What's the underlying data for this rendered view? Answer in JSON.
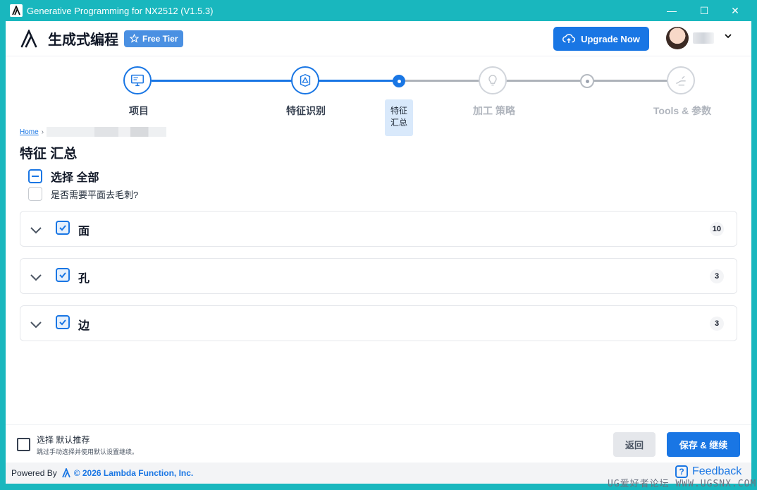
{
  "window": {
    "title": "Generative Programming for NX2512 (V1.5.3)",
    "controls": {
      "minimize": "—",
      "maximize": "☐",
      "close": "✕"
    }
  },
  "header": {
    "app_title": "生成式编程",
    "tier_label": "Free Tier",
    "upgrade_label": "Upgrade Now",
    "accent": "#1976e4"
  },
  "stepper": {
    "steps": [
      {
        "label": "项目",
        "state": "done",
        "icon": "monitor-icon"
      },
      {
        "label": "特征识别",
        "state": "done",
        "icon": "shape-recognition-icon"
      },
      {
        "label": "特征\n汇总",
        "label_line1": "特征",
        "label_line2": "汇总",
        "state": "current"
      },
      {
        "label": "加工 策略",
        "state": "todo",
        "icon": "lightbulb-icon"
      },
      {
        "label": "",
        "state": "todo-dot"
      },
      {
        "label": "Tools & 参数",
        "state": "todo",
        "icon": "tool-hand-icon"
      }
    ]
  },
  "breadcrumb": {
    "home": "Home",
    "separator": "›"
  },
  "page": {
    "title": "特征 汇总",
    "select_all_label": "选择 全部",
    "deburr_label": "是否需要平面去毛刺?"
  },
  "groups": [
    {
      "name": "面",
      "count": "10",
      "checked": true
    },
    {
      "name": "孔",
      "count": "3",
      "checked": true
    },
    {
      "name": "边",
      "count": "3",
      "checked": true
    }
  ],
  "footer": {
    "default_title": "选择 默认推荐",
    "default_desc": "跳过手动选择并使用默认设置继续。",
    "back_label": "返回",
    "save_label": "保存 & 继续"
  },
  "powered": {
    "prefix": "Powered By",
    "company": "© 2026 Lambda Function, Inc.",
    "feedback_label": "Feedback"
  },
  "watermark": "UG爱好者论坛 WWW.UGSNX.COM"
}
